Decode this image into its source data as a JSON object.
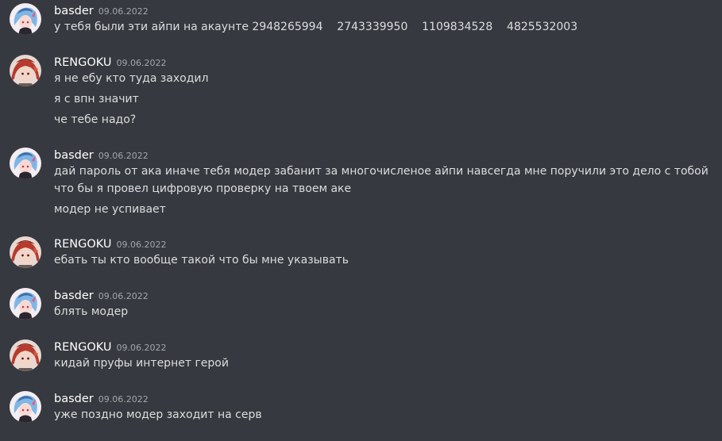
{
  "colors": {
    "background": "#36393f",
    "username": "#ffffff",
    "timestamp": "#a3a6aa",
    "message_text": "#dcddde"
  },
  "messages": [
    {
      "author": "basder",
      "timestamp": "09.06.2022",
      "avatar_icon": "anime-girl-avatar-icon",
      "lines": [
        "у тебя были эти айпи на акаунте 2948265994    2743339950    1109834528    4825532003"
      ]
    },
    {
      "author": "RENGOKU",
      "timestamp": "09.06.2022",
      "avatar_icon": "anime-redhead-avatar-icon",
      "lines": [
        "я не ебу кто туда заходил",
        "я с впн значит",
        "че тебе надо?"
      ]
    },
    {
      "author": "basder",
      "timestamp": "09.06.2022",
      "avatar_icon": "anime-girl-avatar-icon",
      "lines": [
        "дай пароль от ака иначе тебя модер забанит за многочисленое айпи навсегда мне поручили это дело с тобой что бы я провел цифровую проверку на твоем аке",
        "модер не успивает"
      ]
    },
    {
      "author": "RENGOKU",
      "timestamp": "09.06.2022",
      "avatar_icon": "anime-redhead-avatar-icon",
      "lines": [
        "ебать ты кто вообще такой что бы мне указывать"
      ]
    },
    {
      "author": "basder",
      "timestamp": "09.06.2022",
      "avatar_icon": "anime-girl-avatar-icon",
      "lines": [
        "блять модер"
      ]
    },
    {
      "author": "RENGOKU",
      "timestamp": "09.06.2022",
      "avatar_icon": "anime-redhead-avatar-icon",
      "lines": [
        "кидай пруфы интернет герой"
      ]
    },
    {
      "author": "basder",
      "timestamp": "09.06.2022",
      "avatar_icon": "anime-girl-avatar-icon",
      "lines": [
        "уже поздно модер заходит на серв"
      ]
    }
  ]
}
